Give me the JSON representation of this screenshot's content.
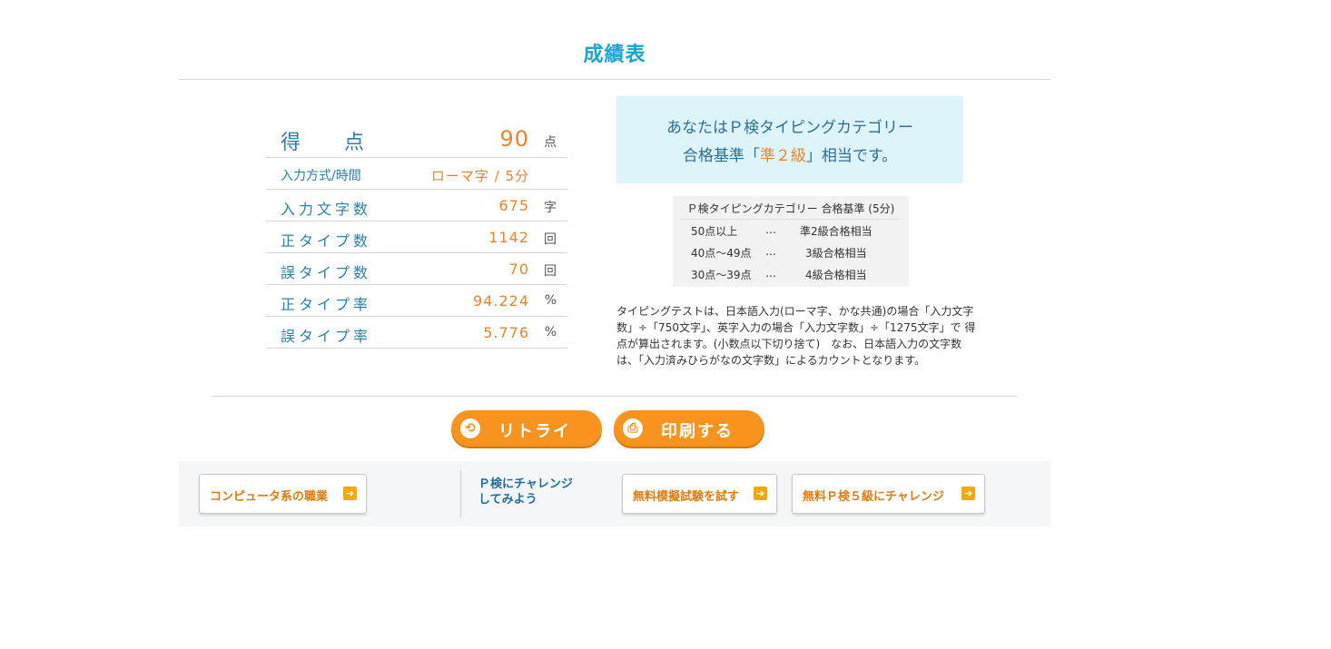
{
  "title": "成績表",
  "results": {
    "score_label": [
      "得",
      "点"
    ],
    "score_value": "90",
    "score_unit": "点",
    "rows": [
      {
        "label": "入力方式/時間",
        "value": "ローマ字 / 5分",
        "unit": ""
      },
      {
        "label": "入力文字数",
        "value": "675",
        "unit": "字"
      },
      {
        "label": "正タイプ数",
        "value": "1142",
        "unit": "回"
      },
      {
        "label": "誤タイプ数",
        "value": "70",
        "unit": "回"
      },
      {
        "label": "正タイプ率",
        "value": "94.224",
        "unit": "%"
      },
      {
        "label": "誤タイプ率",
        "value": "5.776",
        "unit": "%"
      }
    ]
  },
  "certification": {
    "line1": "あなたはＰ検タイピングカテゴリー",
    "line2_prefix": "合格基準「",
    "grade": "準２級",
    "line2_suffix": "」相当です。"
  },
  "criteria": {
    "header": "Ｐ検タイピングカテゴリー 合格基準 (5分)",
    "rows": [
      {
        "range": "50点以上",
        "sep": "…",
        "grade": "準2級合格相当"
      },
      {
        "range": "40点～49点",
        "sep": "…",
        "grade": "3級合格相当"
      },
      {
        "range": "30点～39点",
        "sep": "…",
        "grade": "4級合格相当"
      }
    ]
  },
  "note": {
    "lines": [
      "タイピングテストは、日本語入力(ローマ字、かな共通)の場合「入力文字",
      "数」÷「750文字」、英字入力の場合「入力文字数」÷「1275文字」で 得",
      "点が算出されます。(小数点以下切り捨て)　なお、日本語入力の文字数",
      "は、「入力済みひらがなの文字数」によるカウントとなります。"
    ]
  },
  "buttons": {
    "retry": "リトライ",
    "print": "印刷する"
  },
  "footer": {
    "careers": "コンピュータ系の職業",
    "challenge_line1": "Ｐ検にチャレンジ",
    "challenge_line2": "してみよう",
    "mock_exam": "無料模擬試験を試す",
    "level5": "無料Ｐ検５級にチャレンジ",
    "arrow": "➔"
  },
  "colors": {
    "accent_blue": "#1aa3d4",
    "label_blue": "#2c7fa7",
    "value_orange": "#e8842e",
    "button_orange": "#f7931e",
    "info_bg": "#def4fb"
  },
  "icons": {
    "retry": "refresh-icon",
    "print": "printer-icon",
    "link_arrow": "arrow-right-icon"
  }
}
